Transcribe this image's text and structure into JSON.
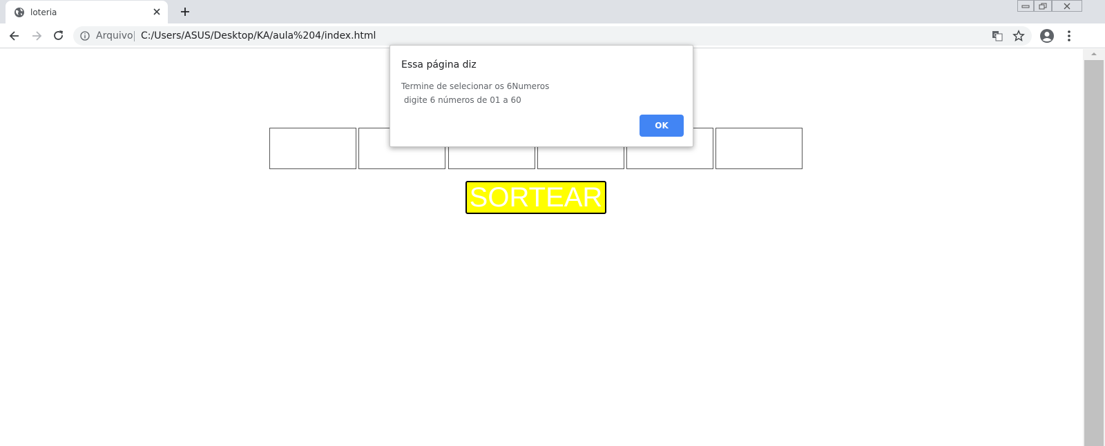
{
  "tab": {
    "title": "loteria"
  },
  "toolbar": {
    "site_chip": "Arquivo",
    "url": "C:/Users/ASUS/Desktop/KA/aula%204/index.html"
  },
  "page": {
    "number_inputs": [
      "",
      "",
      "",
      "",
      "",
      ""
    ],
    "sortear_label": "SORTEAR",
    "sortear_bg": "#ffff00",
    "sortear_text_color": "#ffffff"
  },
  "dialog": {
    "title": "Essa página diz",
    "message": "Termine de selecionar os 6Numeros\n digite 6 números de 01 a 60",
    "ok_label": "OK",
    "ok_color": "#4285f4"
  }
}
